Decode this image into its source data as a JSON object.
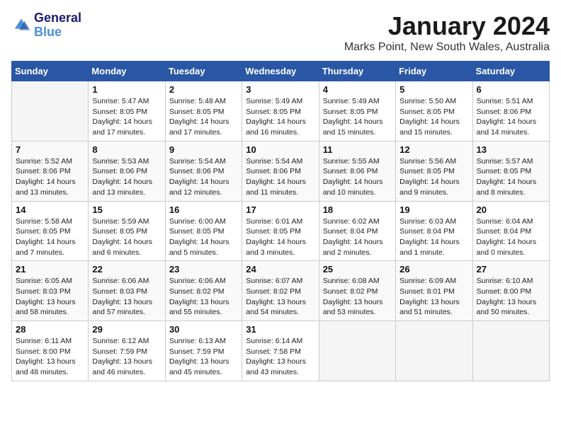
{
  "logo": {
    "line1": "General",
    "line2": "Blue"
  },
  "title": "January 2024",
  "subtitle": "Marks Point, New South Wales, Australia",
  "weekdays": [
    "Sunday",
    "Monday",
    "Tuesday",
    "Wednesday",
    "Thursday",
    "Friday",
    "Saturday"
  ],
  "weeks": [
    [
      {
        "day": "",
        "info": ""
      },
      {
        "day": "1",
        "info": "Sunrise: 5:47 AM\nSunset: 8:05 PM\nDaylight: 14 hours\nand 17 minutes."
      },
      {
        "day": "2",
        "info": "Sunrise: 5:48 AM\nSunset: 8:05 PM\nDaylight: 14 hours\nand 17 minutes."
      },
      {
        "day": "3",
        "info": "Sunrise: 5:49 AM\nSunset: 8:05 PM\nDaylight: 14 hours\nand 16 minutes."
      },
      {
        "day": "4",
        "info": "Sunrise: 5:49 AM\nSunset: 8:05 PM\nDaylight: 14 hours\nand 15 minutes."
      },
      {
        "day": "5",
        "info": "Sunrise: 5:50 AM\nSunset: 8:05 PM\nDaylight: 14 hours\nand 15 minutes."
      },
      {
        "day": "6",
        "info": "Sunrise: 5:51 AM\nSunset: 8:06 PM\nDaylight: 14 hours\nand 14 minutes."
      }
    ],
    [
      {
        "day": "7",
        "info": "Sunrise: 5:52 AM\nSunset: 8:06 PM\nDaylight: 14 hours\nand 13 minutes."
      },
      {
        "day": "8",
        "info": "Sunrise: 5:53 AM\nSunset: 8:06 PM\nDaylight: 14 hours\nand 13 minutes."
      },
      {
        "day": "9",
        "info": "Sunrise: 5:54 AM\nSunset: 8:06 PM\nDaylight: 14 hours\nand 12 minutes."
      },
      {
        "day": "10",
        "info": "Sunrise: 5:54 AM\nSunset: 8:06 PM\nDaylight: 14 hours\nand 11 minutes."
      },
      {
        "day": "11",
        "info": "Sunrise: 5:55 AM\nSunset: 8:06 PM\nDaylight: 14 hours\nand 10 minutes."
      },
      {
        "day": "12",
        "info": "Sunrise: 5:56 AM\nSunset: 8:05 PM\nDaylight: 14 hours\nand 9 minutes."
      },
      {
        "day": "13",
        "info": "Sunrise: 5:57 AM\nSunset: 8:05 PM\nDaylight: 14 hours\nand 8 minutes."
      }
    ],
    [
      {
        "day": "14",
        "info": "Sunrise: 5:58 AM\nSunset: 8:05 PM\nDaylight: 14 hours\nand 7 minutes."
      },
      {
        "day": "15",
        "info": "Sunrise: 5:59 AM\nSunset: 8:05 PM\nDaylight: 14 hours\nand 6 minutes."
      },
      {
        "day": "16",
        "info": "Sunrise: 6:00 AM\nSunset: 8:05 PM\nDaylight: 14 hours\nand 5 minutes."
      },
      {
        "day": "17",
        "info": "Sunrise: 6:01 AM\nSunset: 8:05 PM\nDaylight: 14 hours\nand 3 minutes."
      },
      {
        "day": "18",
        "info": "Sunrise: 6:02 AM\nSunset: 8:04 PM\nDaylight: 14 hours\nand 2 minutes."
      },
      {
        "day": "19",
        "info": "Sunrise: 6:03 AM\nSunset: 8:04 PM\nDaylight: 14 hours\nand 1 minute."
      },
      {
        "day": "20",
        "info": "Sunrise: 6:04 AM\nSunset: 8:04 PM\nDaylight: 14 hours\nand 0 minutes."
      }
    ],
    [
      {
        "day": "21",
        "info": "Sunrise: 6:05 AM\nSunset: 8:03 PM\nDaylight: 13 hours\nand 58 minutes."
      },
      {
        "day": "22",
        "info": "Sunrise: 6:06 AM\nSunset: 8:03 PM\nDaylight: 13 hours\nand 57 minutes."
      },
      {
        "day": "23",
        "info": "Sunrise: 6:06 AM\nSunset: 8:02 PM\nDaylight: 13 hours\nand 55 minutes."
      },
      {
        "day": "24",
        "info": "Sunrise: 6:07 AM\nSunset: 8:02 PM\nDaylight: 13 hours\nand 54 minutes."
      },
      {
        "day": "25",
        "info": "Sunrise: 6:08 AM\nSunset: 8:02 PM\nDaylight: 13 hours\nand 53 minutes."
      },
      {
        "day": "26",
        "info": "Sunrise: 6:09 AM\nSunset: 8:01 PM\nDaylight: 13 hours\nand 51 minutes."
      },
      {
        "day": "27",
        "info": "Sunrise: 6:10 AM\nSunset: 8:00 PM\nDaylight: 13 hours\nand 50 minutes."
      }
    ],
    [
      {
        "day": "28",
        "info": "Sunrise: 6:11 AM\nSunset: 8:00 PM\nDaylight: 13 hours\nand 48 minutes."
      },
      {
        "day": "29",
        "info": "Sunrise: 6:12 AM\nSunset: 7:59 PM\nDaylight: 13 hours\nand 46 minutes."
      },
      {
        "day": "30",
        "info": "Sunrise: 6:13 AM\nSunset: 7:59 PM\nDaylight: 13 hours\nand 45 minutes."
      },
      {
        "day": "31",
        "info": "Sunrise: 6:14 AM\nSunset: 7:58 PM\nDaylight: 13 hours\nand 43 minutes."
      },
      {
        "day": "",
        "info": ""
      },
      {
        "day": "",
        "info": ""
      },
      {
        "day": "",
        "info": ""
      }
    ]
  ]
}
